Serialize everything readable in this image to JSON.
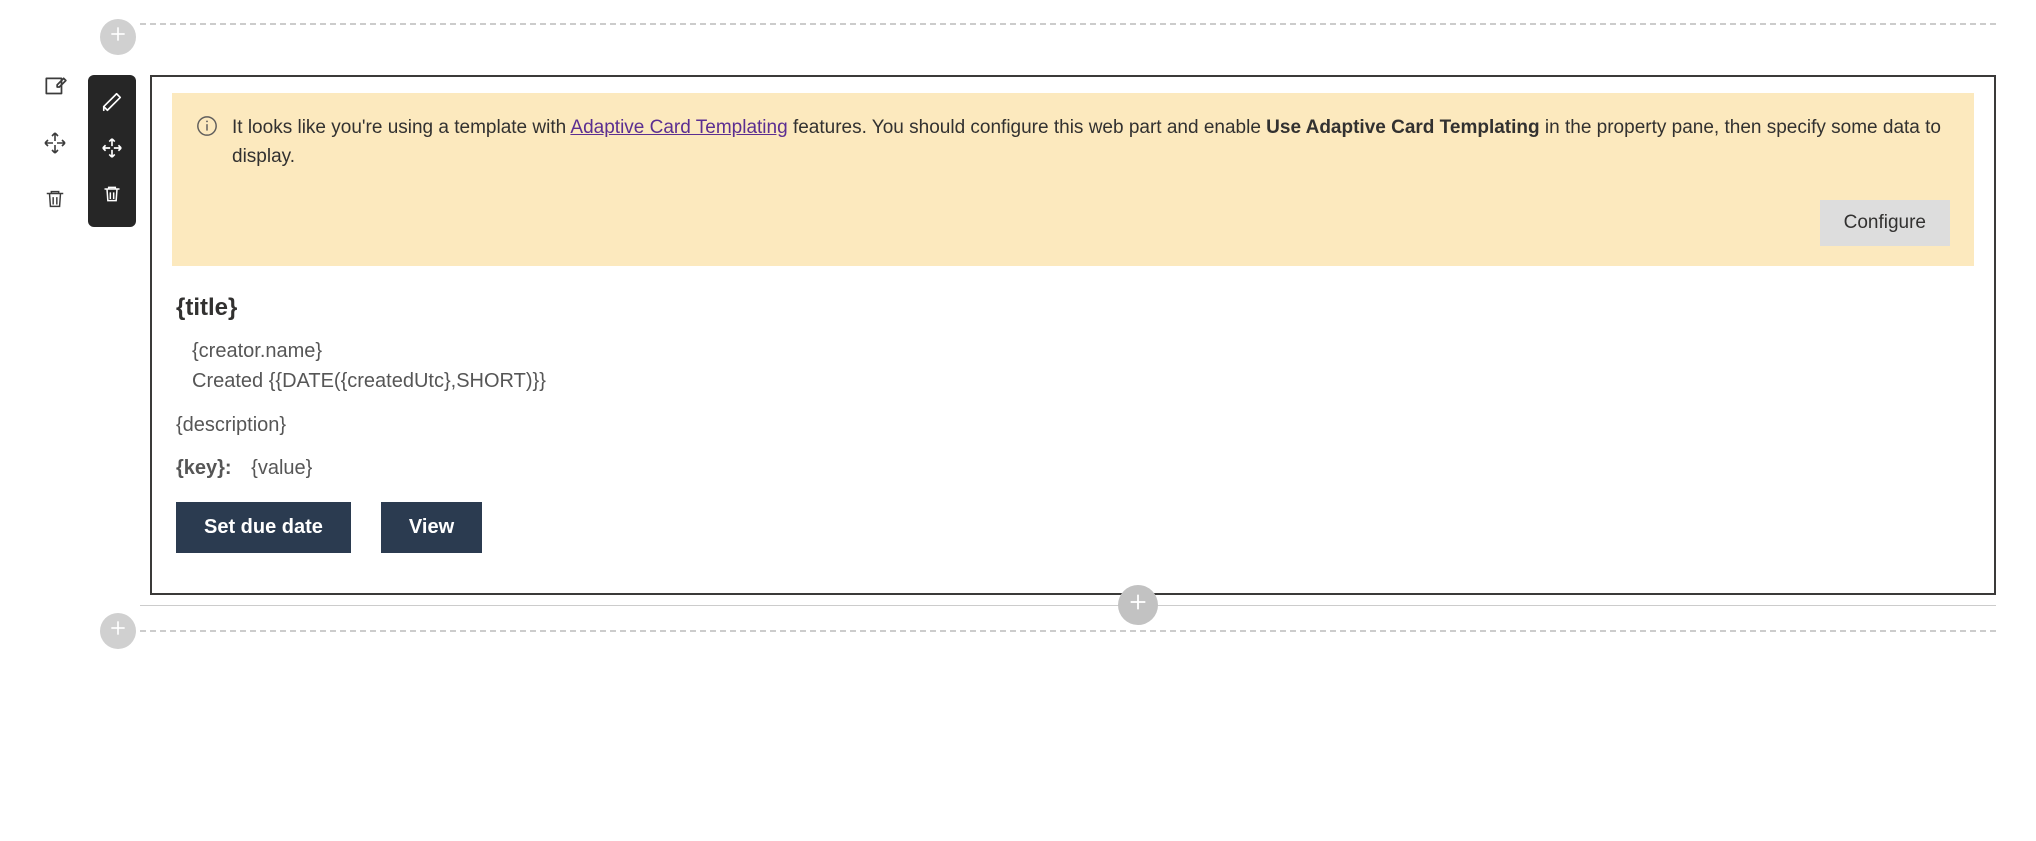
{
  "banner": {
    "pre_link_text": "It looks like you're using a template with ",
    "link_text": "Adaptive Card Templating",
    "post_link_text_1": " features. You should configure this web part and enable ",
    "bold_1": "Use Adaptive Card Templating",
    "post_bold_text": " in the property pane, then specify some data to display.",
    "configure_button": "Configure"
  },
  "card": {
    "title": "{title}",
    "creator_name": "{creator.name}",
    "created_line": "Created {{DATE({createdUtc},SHORT)}}",
    "description": "{description}",
    "key_label": "{key}:",
    "value_label": "{value}",
    "actions": {
      "set_due_date": "Set due date",
      "view": "View"
    }
  },
  "icons": {
    "plus": "plus-icon",
    "edit_note": "edit-note-icon",
    "move_outer": "move-icon",
    "delete_outer": "delete-icon",
    "edit_dark": "edit-icon",
    "move_dark": "move-icon",
    "delete_dark": "delete-icon",
    "info": "info-icon"
  }
}
